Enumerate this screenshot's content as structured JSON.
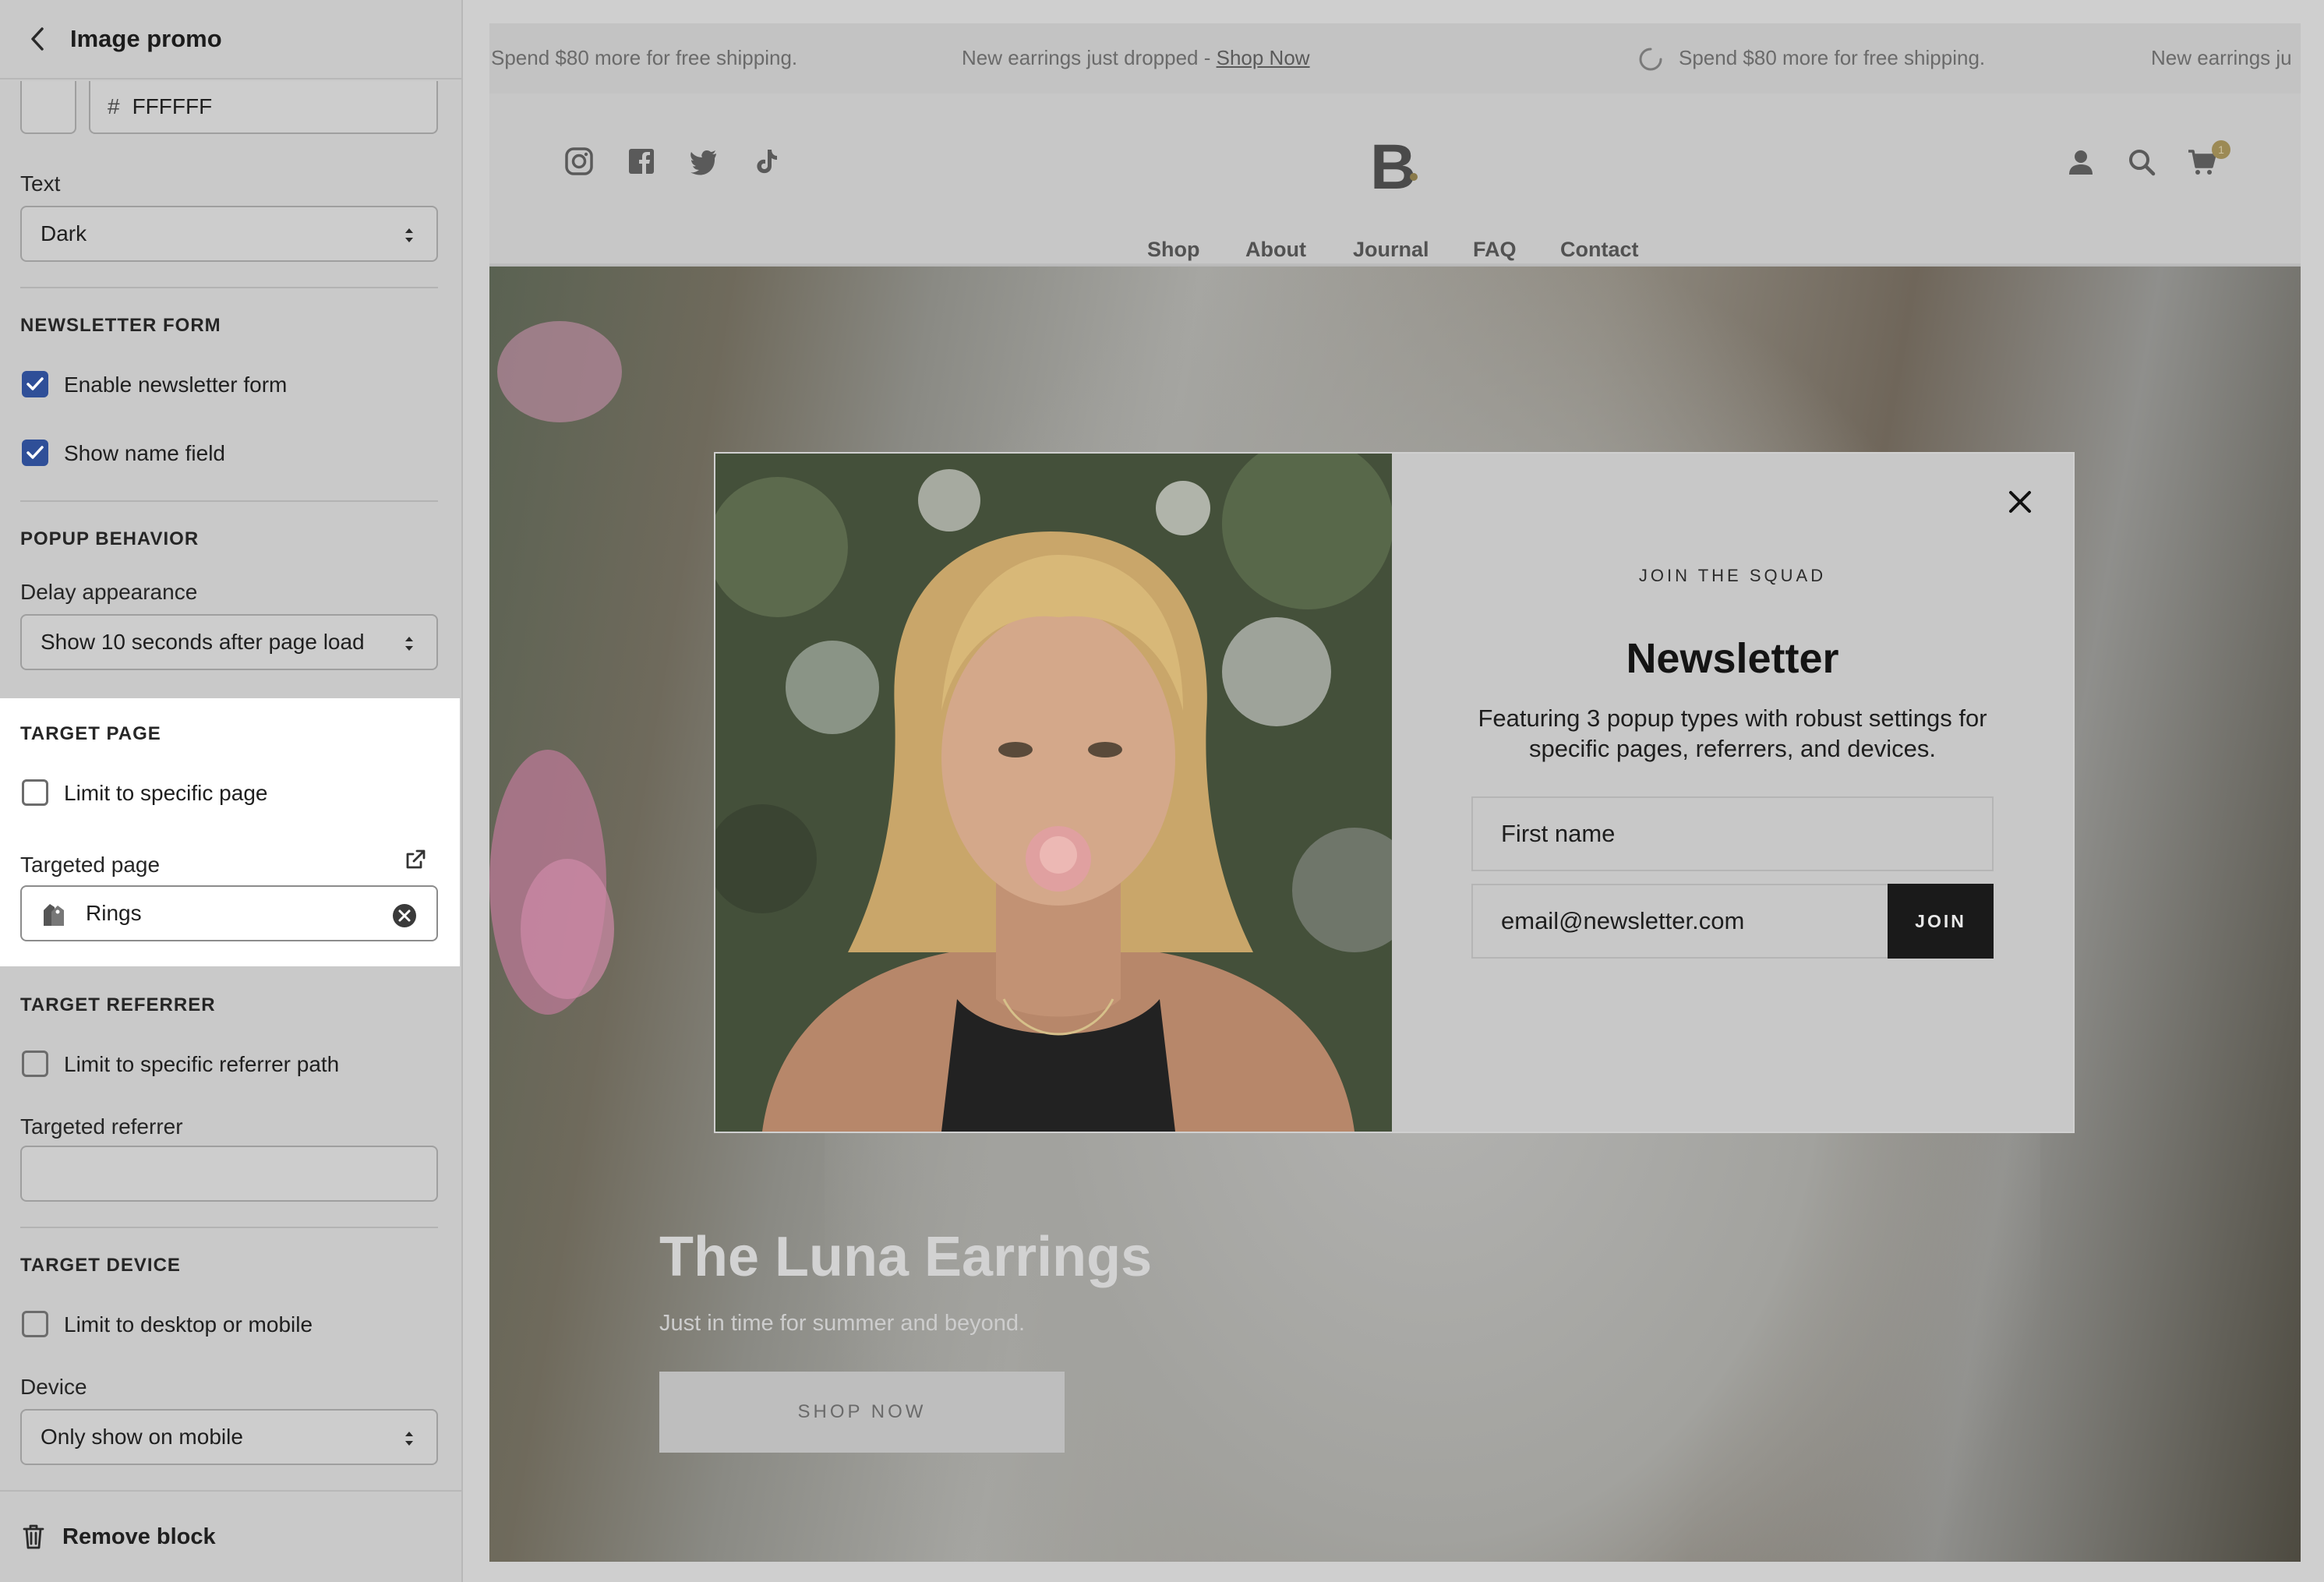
{
  "sidebar": {
    "title": "Image promo",
    "color_hex": "FFFFFF",
    "text_label": "Text",
    "text_value": "Dark",
    "newsletter_section": "NEWSLETTER FORM",
    "enable_newsletter": "Enable newsletter form",
    "enable_newsletter_checked": true,
    "show_name": "Show name field",
    "show_name_checked": true,
    "popup_section": "POPUP BEHAVIOR",
    "delay_label": "Delay appearance",
    "delay_value": "Show 10 seconds after page load",
    "target_page_section": "TARGET PAGE",
    "limit_page": "Limit to specific page",
    "targeted_page_label": "Targeted page",
    "targeted_page_value": "Rings",
    "target_referrer_section": "TARGET REFERRER",
    "limit_referrer": "Limit to specific referrer path",
    "targeted_referrer_label": "Targeted referrer",
    "target_device_section": "TARGET DEVICE",
    "limit_device": "Limit to desktop or mobile",
    "device_label": "Device",
    "device_value": "Only show on mobile",
    "remove_block": "Remove block"
  },
  "preview": {
    "announcements": [
      "Spend $80 more for free shipping.",
      "New earrings just dropped - ",
      "Spend $80 more for free shipping.",
      "New earrings ju"
    ],
    "shop_now_link": "Shop Now",
    "logo": "B",
    "cart_count": "1",
    "nav": [
      "Shop",
      "About",
      "Journal",
      "FAQ",
      "Contact"
    ],
    "hero_title": "The Luna Earrings",
    "hero_subtitle": "Just in time for summer and beyond.",
    "hero_button": "SHOP NOW"
  },
  "popup": {
    "kicker": "JOIN THE SQUAD",
    "title": "Newsletter",
    "description": "Featuring 3 popup types with robust settings for specific pages, referrers, and devices.",
    "first_name_placeholder": "First name",
    "email_placeholder": "email@newsletter.com",
    "join_button": "JOIN"
  },
  "colors": {
    "checkbox_accent": "#2f4f98",
    "join_button_bg": "#1a1a1a",
    "logo_dot": "#8a7a4a"
  }
}
